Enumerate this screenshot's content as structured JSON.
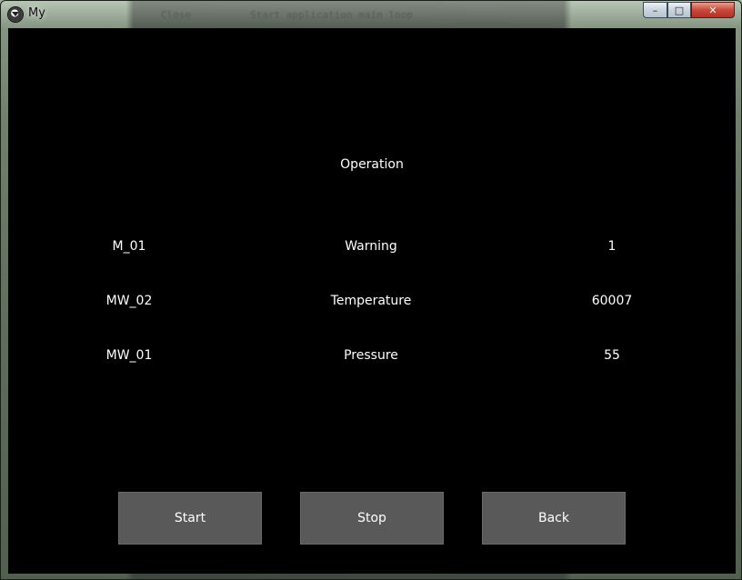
{
  "window": {
    "title": "My",
    "background_tabs": [
      "Close",
      "Start application main loop"
    ],
    "controls": {
      "minimize": "–",
      "maximize": "□",
      "close": "✕"
    }
  },
  "screen": {
    "heading": "Operation",
    "rows": [
      {
        "address": "M_01",
        "name": "Warning",
        "value": "1"
      },
      {
        "address": "MW_02",
        "name": "Temperature",
        "value": "60007"
      },
      {
        "address": "MW_01",
        "name": "Pressure",
        "value": "55"
      }
    ]
  },
  "buttons": {
    "start": "Start",
    "stop": "Stop",
    "back": "Back"
  },
  "colors": {
    "background": "#000000",
    "text": "#ffffff",
    "button": "#595959"
  }
}
